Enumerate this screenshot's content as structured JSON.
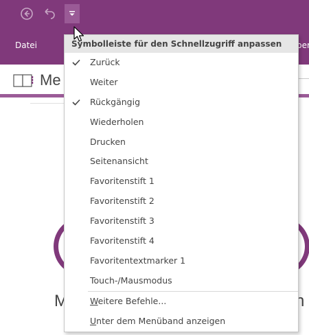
{
  "ribbon": {
    "tab_file": "Datei",
    "tab_partial": "ber"
  },
  "notebook": {
    "title_partial": "Me"
  },
  "background": {
    "letter_left": "M",
    "letter_right": "n"
  },
  "menu": {
    "header": "Symbolleiste für den Schnellzugriff anpassen",
    "items": [
      {
        "label": "Zurück",
        "checked": true
      },
      {
        "label": "Weiter",
        "checked": false
      },
      {
        "label": "Rückgängig",
        "checked": true
      },
      {
        "label": "Wiederholen",
        "checked": false
      },
      {
        "label": "Drucken",
        "checked": false
      },
      {
        "label": "Seitenansicht",
        "checked": false
      },
      {
        "label": "Favoritenstift 1",
        "checked": false
      },
      {
        "label": "Favoritenstift 2",
        "checked": false
      },
      {
        "label": "Favoritenstift 3",
        "checked": false
      },
      {
        "label": "Favoritenstift 4",
        "checked": false
      },
      {
        "label": "Favoritentextmarker 1",
        "checked": false
      },
      {
        "label": "Touch-/Mausmodus",
        "checked": false
      }
    ],
    "more_commands": {
      "accel": "W",
      "rest": "eitere Befehle..."
    },
    "show_below": {
      "accel": "U",
      "rest": "nter dem Menüband anzeigen"
    }
  },
  "colors": {
    "accent": "#80397b",
    "check": "#444444"
  },
  "icons": {
    "back": "circle-arrow-left-icon",
    "undo": "undo-arrow-icon",
    "customize": "customize-dropdown-icon",
    "notebook": "notebook-icon",
    "check": "checkmark-icon",
    "cursor": "mouse-pointer-icon"
  }
}
